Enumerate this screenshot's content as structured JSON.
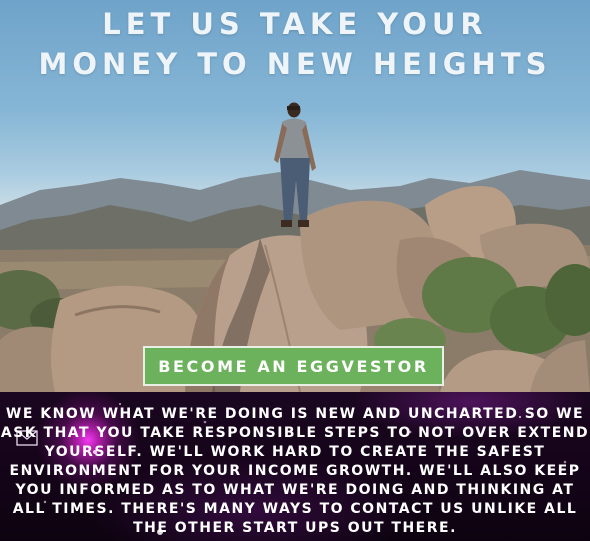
{
  "hero": {
    "headline_line1": "LET US TAKE YOUR",
    "headline_line2": "MONEY TO NEW HEIGHTS",
    "cta_label": "BECOME AN EGGVESTOR"
  },
  "info": {
    "paragraph": "WE KNOW WHAT WE'RE DOING IS NEW AND UNCHARTED SO WE ASK THAT YOU TAKE RESPONSIBLE STEPS TO NOT OVER EXTEND YOURSELF. WE'LL WORK HARD TO CREATE THE SAFEST ENVIRONMENT FOR YOUR INCOME GROWTH. WE'LL ALSO KEEP YOU INFORMED AS TO WHAT WE'RE DOING AND THINKING AT ALL TIMES. THERE'S MANY WAYS TO CONTACT US UNLIKE ALL THE OTHER START UPS OUT THERE.",
    "icon": "mail-icon"
  },
  "colors": {
    "cta_green": "#6cb25c",
    "info_bg": "#140418",
    "glow_magenta": "#e828dc",
    "headline_text": "#eef4f8"
  }
}
